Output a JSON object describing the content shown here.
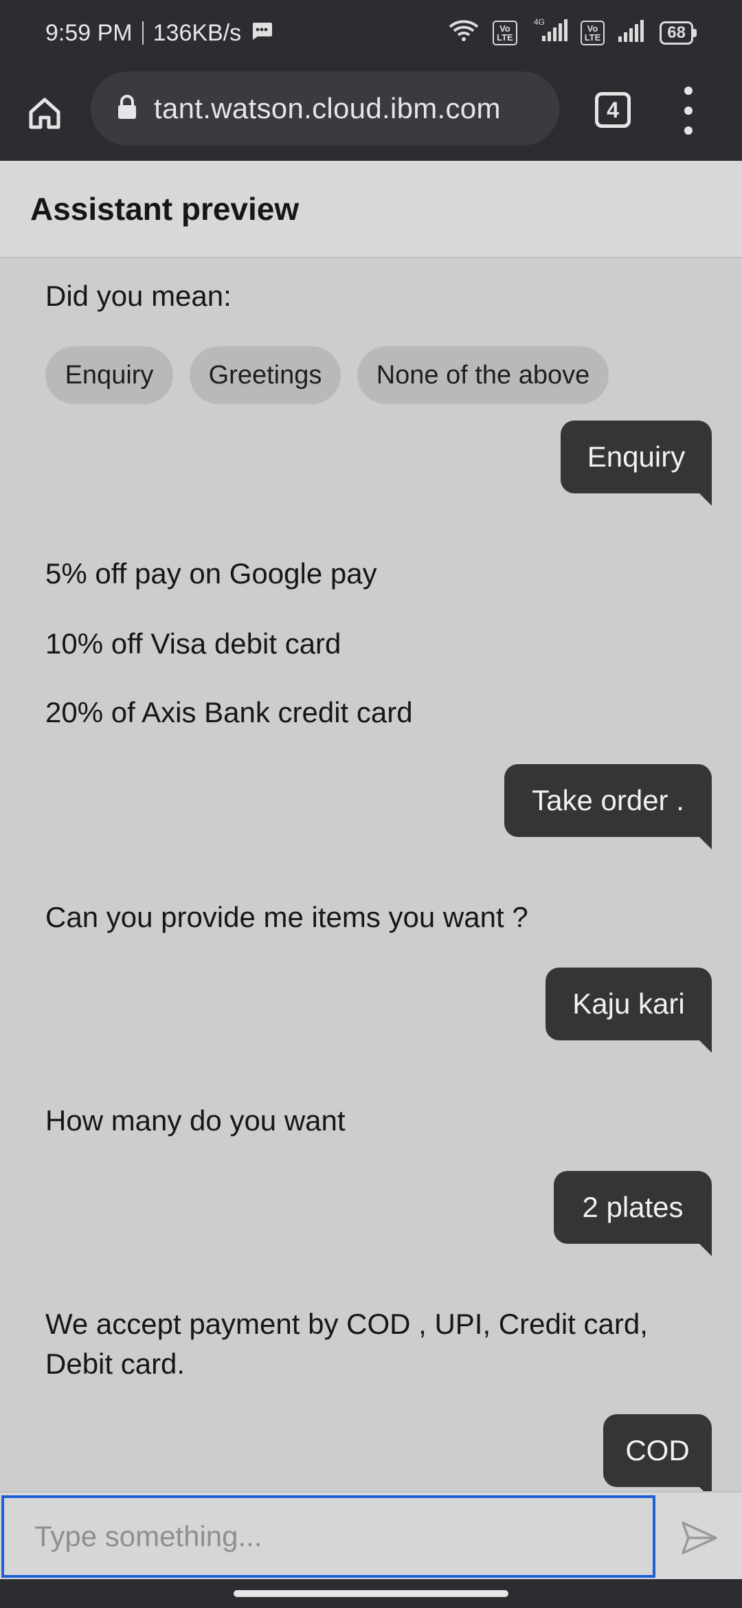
{
  "status_bar": {
    "time": "9:59 PM",
    "speed": "136KB/s",
    "network_label": "4G",
    "volte_label": "Vo\nLTE",
    "battery": "68"
  },
  "browser": {
    "url": "tant.watson.cloud.ibm.com",
    "tab_count": "4"
  },
  "header": {
    "title": "Assistant preview"
  },
  "chat": {
    "did_you_mean": "Did you mean:",
    "chips": [
      "Enquiry",
      "Greetings",
      "None of the above"
    ],
    "user_1": "Enquiry",
    "offer_1": "5% off pay on Google pay",
    "offer_2": "10% off Visa debit card",
    "offer_3": "20% of Axis Bank credit card",
    "user_2": "Take order .",
    "bot_items": "Can you provide me items you want ?",
    "user_3": "Kaju kari",
    "bot_count": "How many do you want",
    "user_4": "2 plates",
    "bot_payment_line1": "We accept payment by COD , UPI, Credit card,",
    "bot_payment_line2": "Debit card.",
    "user_5": "COD"
  },
  "input": {
    "placeholder": "Type something..."
  },
  "icons": {
    "home": "home-icon",
    "lock": "lock-icon",
    "menu": "more-vert-icon",
    "send": "send-icon",
    "wifi": "wifi-icon",
    "signal": "signal-icon",
    "message": "message-icon"
  }
}
